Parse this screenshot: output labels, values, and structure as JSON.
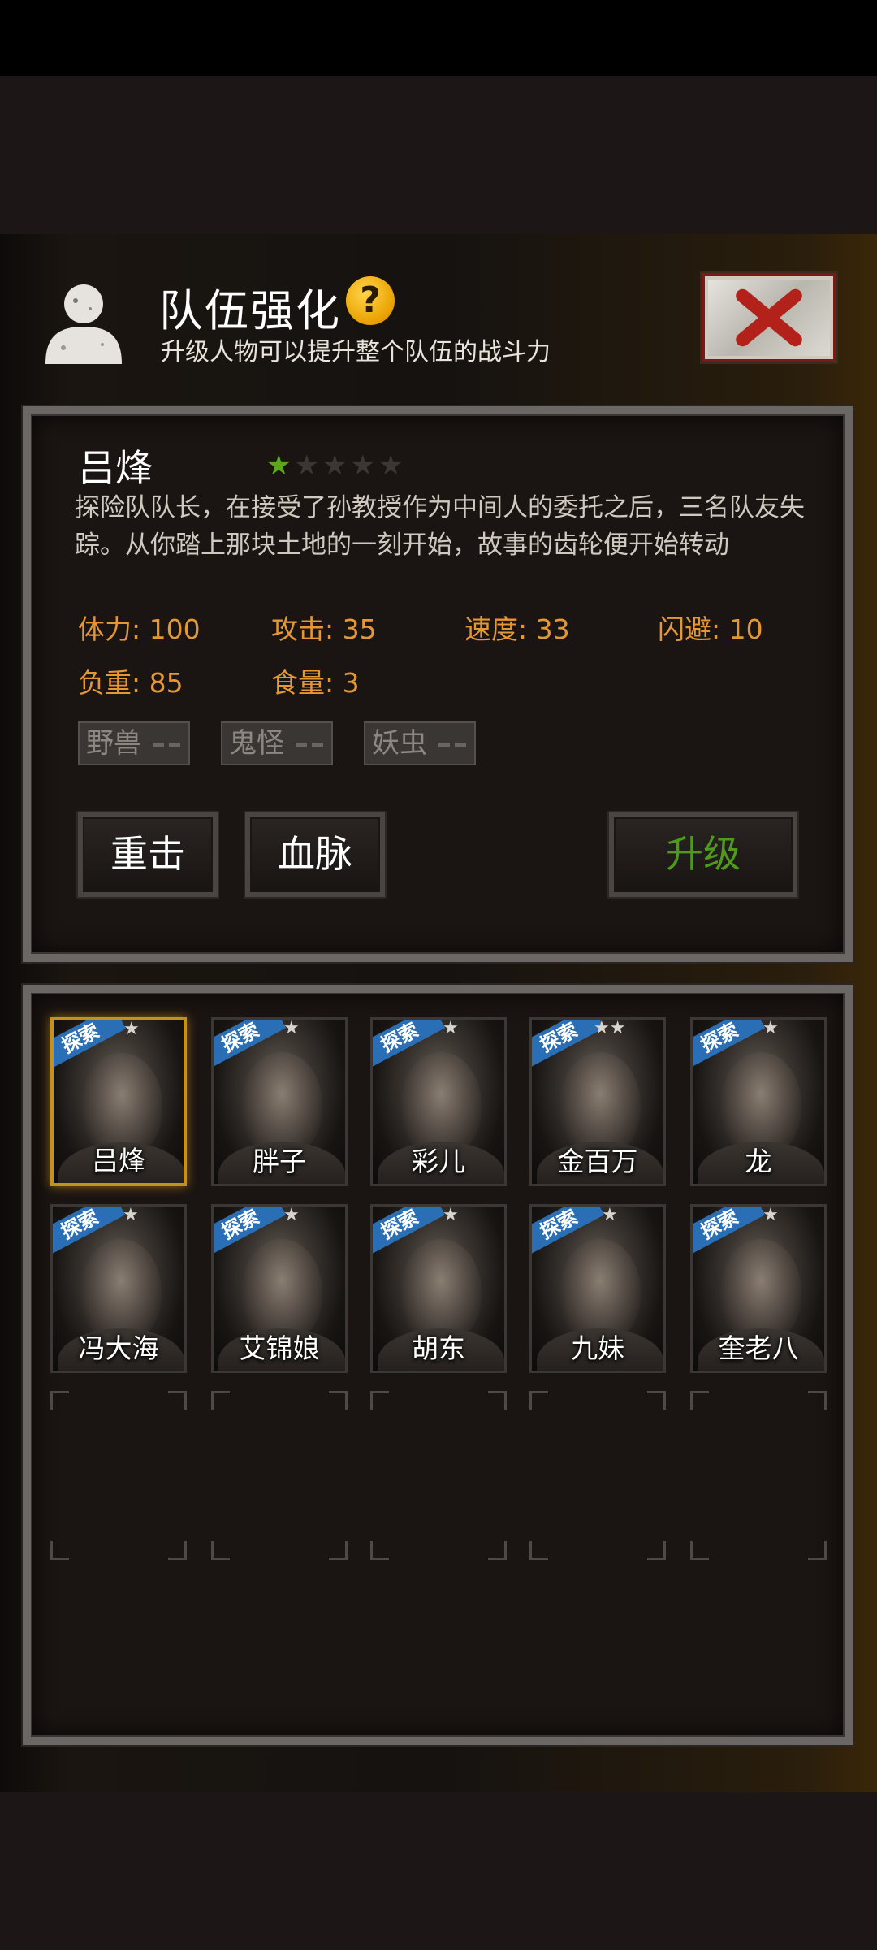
{
  "header": {
    "title": "队伍强化",
    "help_icon": "?",
    "subtitle": "升级人物可以提升整个队伍的战斗力"
  },
  "selected_character": {
    "name": "吕烽",
    "star_rating": 1,
    "star_max": 5,
    "description": "探险队队长，在接受了孙教授作为中间人的委托之后，三名队友失踪。从你踏上那块土地的一刻开始，故事的齿轮便开始转动",
    "stats": {
      "stamina": "体力: 100",
      "attack": "攻击: 35",
      "speed": "速度: 33",
      "dodge": "闪避: 10",
      "load": "负重: 85",
      "food": "食量: 3"
    },
    "tags": [
      "野兽",
      "鬼怪",
      "妖虫"
    ]
  },
  "actions": {
    "heavy_strike": "重击",
    "bloodline": "血脉",
    "upgrade": "升级"
  },
  "roster": {
    "ribbon_label": "探索",
    "characters": [
      {
        "name": "吕烽",
        "stars": "★",
        "selected": true
      },
      {
        "name": "胖子",
        "stars": "★"
      },
      {
        "name": "彩儿",
        "stars": "★"
      },
      {
        "name": "金百万",
        "stars": "★★"
      },
      {
        "name": "龙",
        "stars": "★"
      },
      {
        "name": "冯大海",
        "stars": "★"
      },
      {
        "name": "艾锦娘",
        "stars": "★"
      },
      {
        "name": "胡东",
        "stars": "★"
      },
      {
        "name": "九妹",
        "stars": "★"
      },
      {
        "name": "奎老八",
        "stars": "★"
      }
    ]
  },
  "colors": {
    "accent_orange": "#e49834",
    "upgrade_green": "#4e9a1c",
    "star_green": "#5aa81e",
    "ribbon_blue": "#2a6fb5",
    "selected_gold": "#c6901c"
  }
}
